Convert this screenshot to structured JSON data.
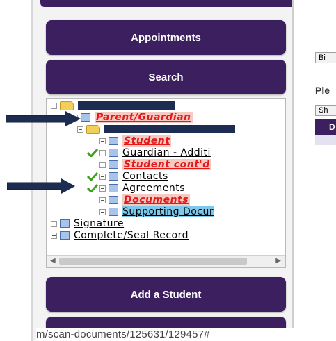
{
  "sidebar": {
    "buttons": {
      "appointments": "Appointments",
      "search": "Search",
      "add_student": "Add a Student"
    },
    "tree": {
      "items": [
        {
          "label": "Parent/Guardian"
        },
        {
          "label": "Student"
        },
        {
          "label": "Guardian - Additi"
        },
        {
          "label": "Student cont'd"
        },
        {
          "label": "Contacts"
        },
        {
          "label": "Agreements"
        },
        {
          "label": "Documents"
        },
        {
          "label": "Supporting Docur"
        },
        {
          "label": "Signature"
        },
        {
          "label": "Complete/Seal Record"
        }
      ]
    }
  },
  "main": {
    "button_1": "Bi",
    "prompt": "Ple",
    "select_value": "Sh",
    "header_cell": "D"
  },
  "status_bar": {
    "url": "m/scan-documents/125631/129457#"
  },
  "colors": {
    "brand": "#3b1f5e",
    "alert_text": "#e21a1a",
    "alert_bg": "#f6c9c3",
    "selected_bg": "#7fc8ea",
    "redaction": "#1d2d52",
    "check": "#3ca21a"
  },
  "icons": [
    "folder-icon",
    "document-icon",
    "checkmark-icon",
    "expander-icon",
    "arrow-icon"
  ]
}
